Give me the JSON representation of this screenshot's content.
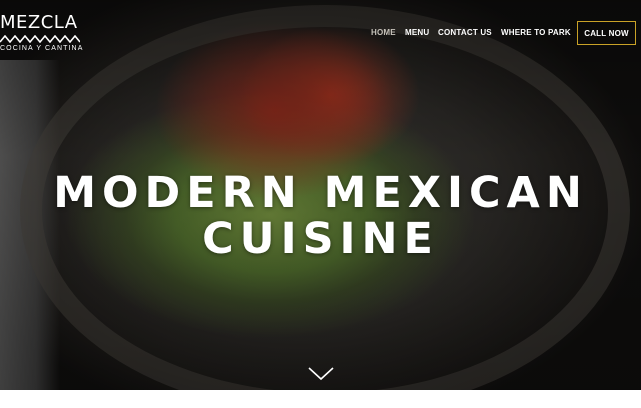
{
  "brand": {
    "name": "MEZCLA",
    "tagline": "COCINA Y CANTINA"
  },
  "nav": {
    "items": [
      {
        "label": "HOME",
        "active": true
      },
      {
        "label": "MENU",
        "active": false
      },
      {
        "label": "CONTACT US",
        "active": false
      },
      {
        "label": "WHERE TO PARK",
        "active": false
      }
    ],
    "call_label": "CALL NOW"
  },
  "hero": {
    "headline_line1": "MODERN MEXICAN",
    "headline_line2": "CUISINE"
  },
  "colors": {
    "accent_border": "#c9a227",
    "active_nav": "#c7c3bb",
    "text": "#ffffff"
  },
  "icons": {
    "scroll": "chevron-down-icon",
    "logo_pattern": "zigzag-icon"
  }
}
